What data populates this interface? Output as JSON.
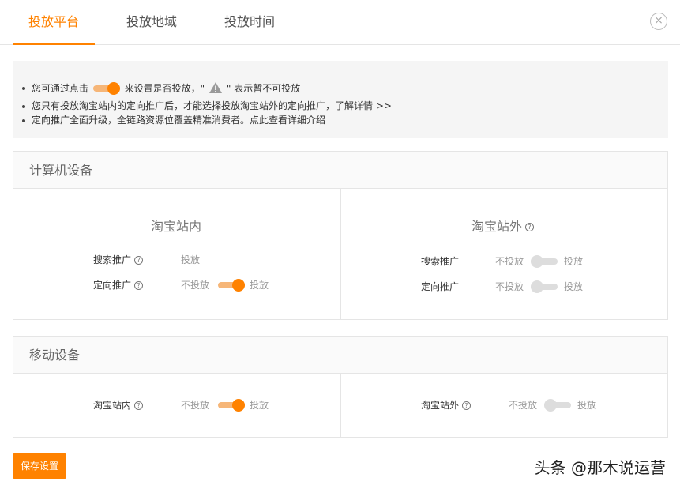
{
  "tabs": [
    {
      "label": "投放平台",
      "active": true
    },
    {
      "label": "投放地域",
      "active": false
    },
    {
      "label": "投放时间",
      "active": false
    }
  ],
  "close_symbol": "×",
  "notice": {
    "line1_before": "您可通过点击",
    "line1_middle": "来设置是否投放，\"",
    "line1_after": "\" 表示暂不可投放",
    "line2_text": "您只有投放淘宝站内的定向推广后，才能选择投放淘宝站外的定向推广，",
    "line2_link": "了解详情 >>",
    "line3_text": "定向推广全面升级，全链路资源位覆盖精准消费者。",
    "line3_link": "点此查看详细介绍"
  },
  "pc_panel": {
    "title": "计算机设备",
    "inside": {
      "title": "淘宝站内",
      "rows": [
        {
          "label": "搜索推广",
          "off_label": "",
          "on_label": "投放",
          "toggle": null
        },
        {
          "label": "定向推广",
          "off_label": "不投放",
          "on_label": "投放",
          "toggle": "on"
        }
      ]
    },
    "outside": {
      "title": "淘宝站外",
      "rows": [
        {
          "label": "搜索推广",
          "off_label": "不投放",
          "on_label": "投放",
          "toggle": "off"
        },
        {
          "label": "定向推广",
          "off_label": "不投放",
          "on_label": "投放",
          "toggle": "off"
        }
      ]
    }
  },
  "mobile_panel": {
    "title": "移动设备",
    "inside": {
      "label": "淘宝站内",
      "off_label": "不投放",
      "on_label": "投放",
      "toggle": "on"
    },
    "outside": {
      "label": "淘宝站外",
      "off_label": "不投放",
      "on_label": "投放",
      "toggle": "off"
    }
  },
  "help_symbol": "?",
  "save_label": "保存设置",
  "watermark": "头条 @那木说运营",
  "colors": {
    "accent": "#ff8200",
    "accent_light": "#f6b678",
    "toggle_off": "#dddddd"
  }
}
